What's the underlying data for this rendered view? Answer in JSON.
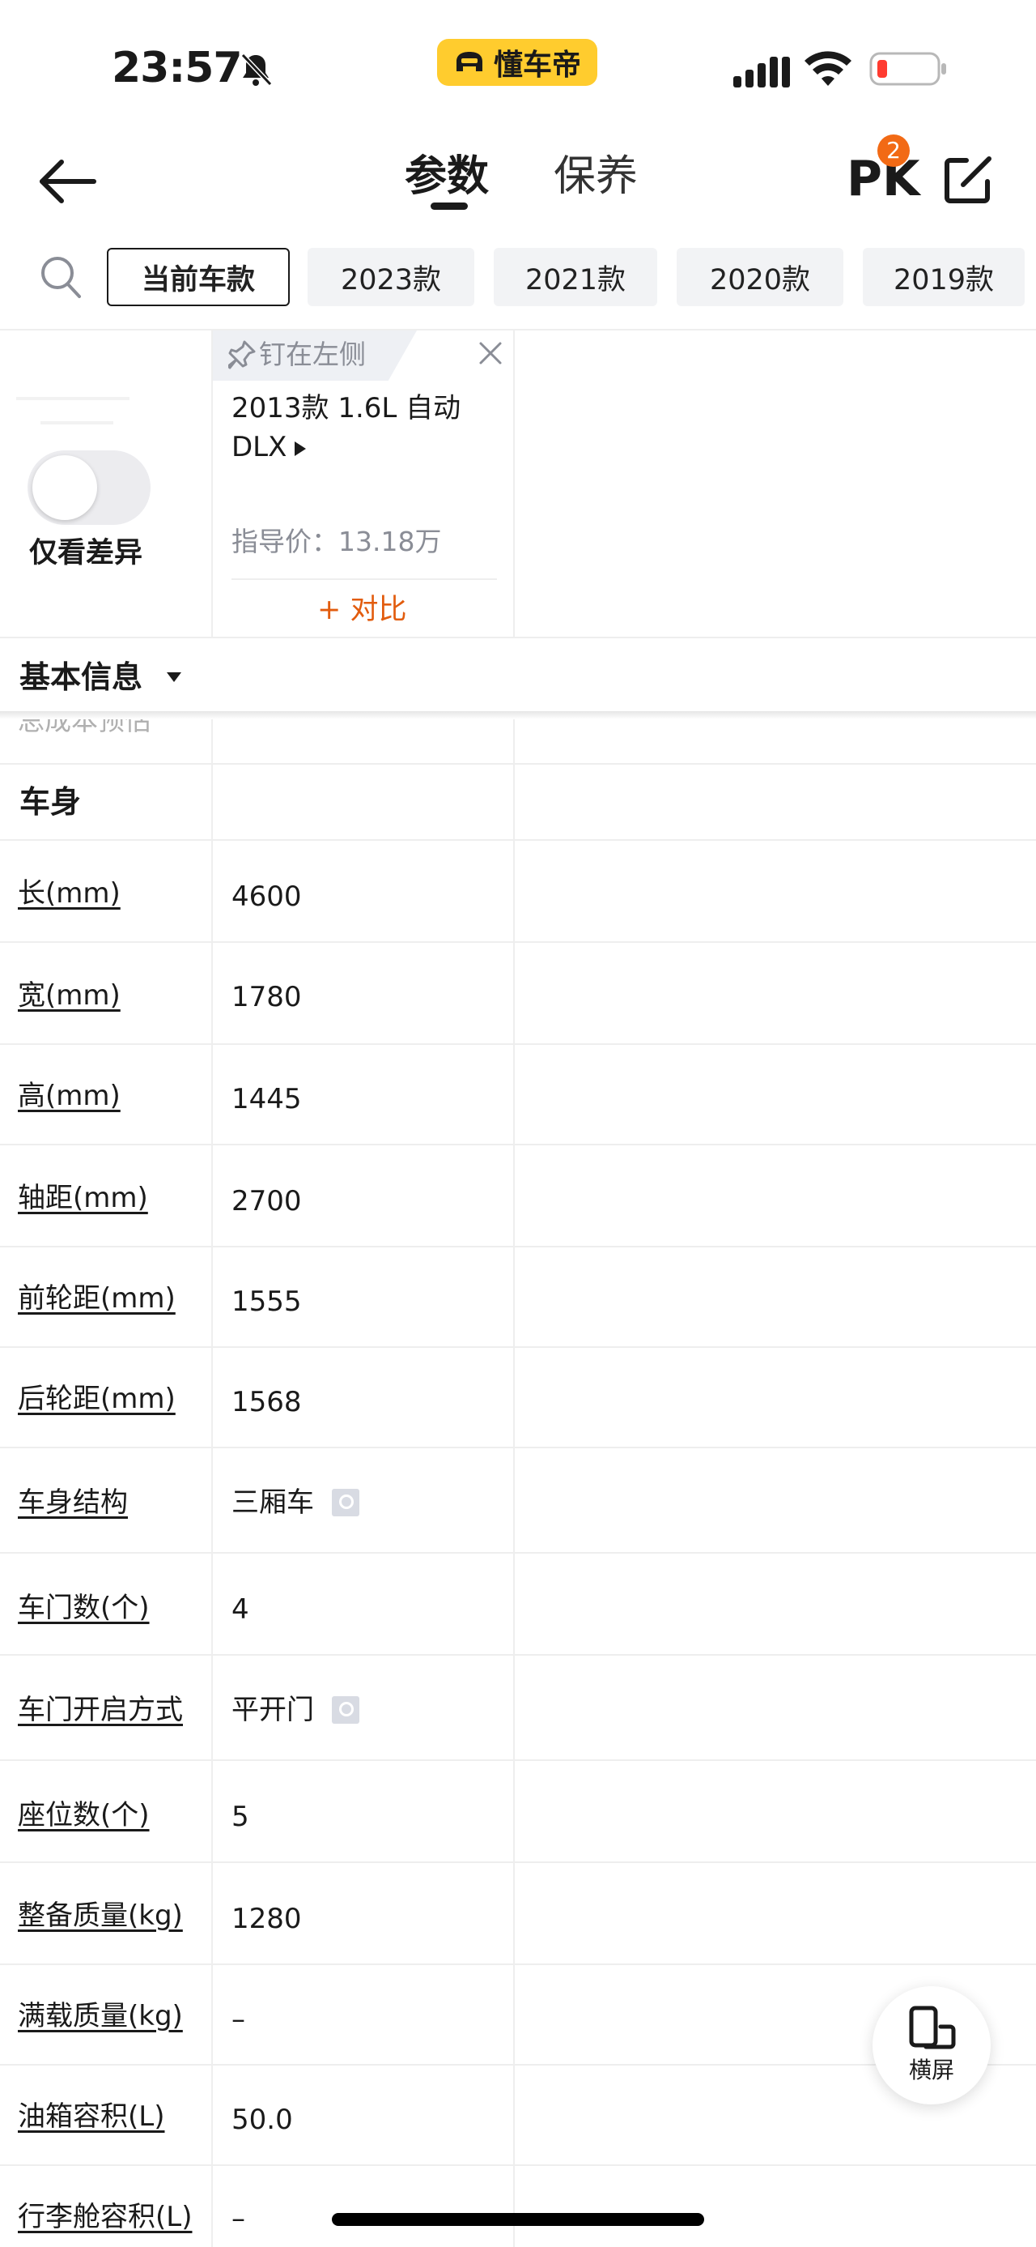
{
  "status_bar": {
    "time": "23:57"
  },
  "header": {
    "logo_text": "懂车帝",
    "tabs": [
      {
        "label": "参数",
        "active": true
      },
      {
        "label": "保养",
        "active": false
      }
    ],
    "pk_label": "PK",
    "pk_count": "2"
  },
  "years": [
    {
      "label": "当前车款",
      "active": true
    },
    {
      "label": "2023款",
      "active": false
    },
    {
      "label": "2021款",
      "active": false
    },
    {
      "label": "2020款",
      "active": false
    },
    {
      "label": "2019款",
      "active": false
    }
  ],
  "card": {
    "diff_toggle_label": "仅看差异",
    "diff_toggle_on": false,
    "pin_label": "钉在左侧",
    "model_name": "2013款 1.6L 自动 DLX",
    "guide_price": "指导价：13.18万",
    "compare_label": "+ 对比"
  },
  "sections": {
    "basic": "基本信息",
    "basic_cut_row": "总成本预估",
    "body": "车身"
  },
  "params": [
    {
      "label": "长(mm)",
      "value": "4600"
    },
    {
      "label": "宽(mm)",
      "value": "1780"
    },
    {
      "label": "高(mm)",
      "value": "1445"
    },
    {
      "label": "轴距(mm)",
      "value": "2700"
    },
    {
      "label": "前轮距(mm)",
      "value": "1555"
    },
    {
      "label": "后轮距(mm)",
      "value": "1568"
    },
    {
      "label": "车身结构",
      "value": "三厢车",
      "has_image": true
    },
    {
      "label": "车门数(个)",
      "value": "4"
    },
    {
      "label": "车门开启方式",
      "value": "平开门",
      "has_image": true
    },
    {
      "label": "座位数(个)",
      "value": "5"
    },
    {
      "label": "整备质量(kg)",
      "value": "1280"
    },
    {
      "label": "满载质量(kg)",
      "value": "–"
    },
    {
      "label": "油箱容积(L)",
      "value": "50.0"
    },
    {
      "label": "行李舱容积(L)",
      "value": "–"
    }
  ],
  "floating": {
    "rotate_label": "横屏"
  },
  "colors": {
    "accent": "#e25c0e",
    "logo_bg": "#ffcc2e",
    "badge": "#f26a15"
  }
}
